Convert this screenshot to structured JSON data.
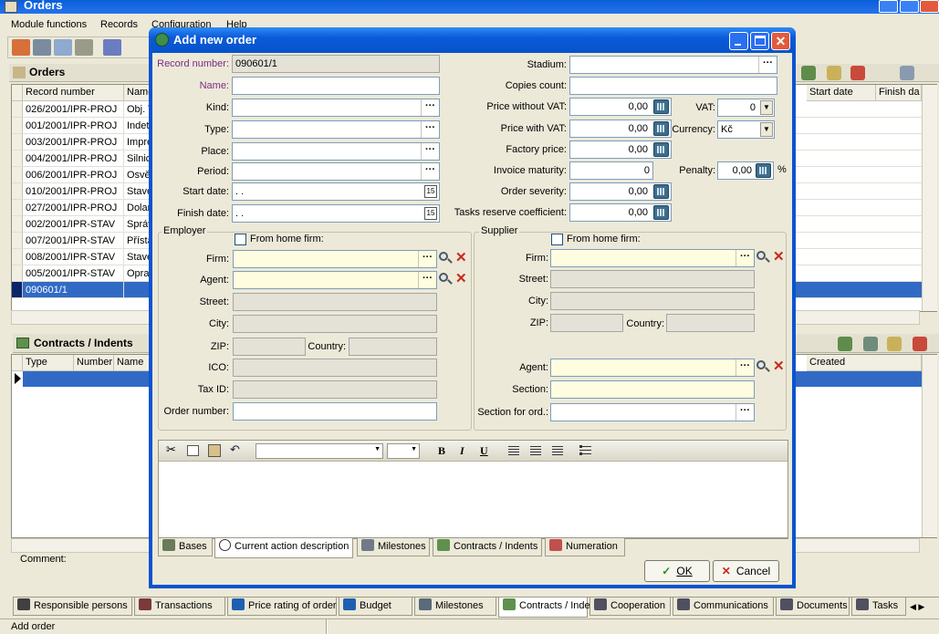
{
  "app": {
    "title": "Orders",
    "status": "Add order"
  },
  "menu": [
    "Module functions",
    "Records",
    "Configuration",
    "Help"
  ],
  "orders_panel": {
    "title": "Orders",
    "columns": [
      "Record number",
      "Name"
    ],
    "right_columns": [
      "Start date",
      "Finish da"
    ],
    "rows": [
      {
        "num": "026/2001/IPR-PROJ",
        "name": "Obj. T"
      },
      {
        "num": "001/2001/IPR-PROJ",
        "name": "Indet"
      },
      {
        "num": "003/2001/IPR-PROJ",
        "name": "Impre"
      },
      {
        "num": "004/2001/IPR-PROJ",
        "name": "Silnic"
      },
      {
        "num": "006/2001/IPR-PROJ",
        "name": "Osvě"
      },
      {
        "num": "010/2001/IPR-PROJ",
        "name": "Stave"
      },
      {
        "num": "027/2001/IPR-PROJ",
        "name": "Dolar"
      },
      {
        "num": "002/2001/IPR-STAV",
        "name": "Správ"
      },
      {
        "num": "007/2001/IPR-STAV",
        "name": "Přísta"
      },
      {
        "num": "008/2001/IPR-STAV",
        "name": "Stave"
      },
      {
        "num": "005/2001/IPR-STAV",
        "name": "Oprav"
      },
      {
        "num": "090601/1",
        "name": ""
      }
    ]
  },
  "contracts_panel": {
    "title": "Contracts / Indents",
    "columns": [
      "Type",
      "Number",
      "Name"
    ],
    "right_columns": [
      "Created"
    ],
    "comment_label": "Comment:"
  },
  "bottom_tabs": [
    "Responsible persons",
    "Transactions",
    "Price rating of order",
    "Budget",
    "Milestones",
    "Contracts / Indents",
    "Cooperation",
    "Communications",
    "Documents",
    "Tasks"
  ],
  "dialog": {
    "title": "Add new order",
    "left": {
      "record_number_label": "Record number:",
      "record_number": "090601/1",
      "name_label": "Name:",
      "kind_label": "Kind:",
      "type_label": "Type:",
      "place_label": "Place:",
      "period_label": "Period:",
      "start_date_label": "Start date:",
      "start_date": " .  .",
      "finish_date_label": "Finish date:",
      "finish_date": " .  ."
    },
    "right": {
      "stadium_label": "Stadium:",
      "copies_label": "Copies count:",
      "price_wo_vat_label": "Price without VAT:",
      "price_wo_vat": "0,00",
      "vat_label": "VAT:",
      "vat": "0",
      "price_w_vat_label": "Price with VAT:",
      "price_w_vat": "0,00",
      "currency_label": "Currency:",
      "currency": "Kč",
      "factory_price_label": "Factory price:",
      "factory_price": "0,00",
      "invoice_maturity_label": "Invoice maturity:",
      "invoice_maturity": "0",
      "penalty_label": "Penalty:",
      "penalty": "0,00",
      "penalty_unit": "%",
      "severity_label": "Order severity:",
      "severity": "0,00",
      "reserve_label": "Tasks reserve coefficient:",
      "reserve": "0,00"
    },
    "employer": {
      "title": "Employer",
      "home_firm_label": "From home firm:",
      "firm_label": "Firm:",
      "agent_label": "Agent:",
      "street_label": "Street:",
      "city_label": "City:",
      "zip_label": "ZIP:",
      "country_label": "Country:",
      "ico_label": "ICO:",
      "taxid_label": "Tax ID:",
      "order_number_label": "Order number:"
    },
    "supplier": {
      "title": "Supplier",
      "home_firm_label": "From home firm:",
      "firm_label": "Firm:",
      "street_label": "Street:",
      "city_label": "City:",
      "zip_label": "ZIP:",
      "country_label": "Country:",
      "agent_label": "Agent:",
      "section_label": "Section:",
      "section_ord_label": "Section for ord.:"
    },
    "editor_buttons": {
      "bold": "B",
      "italic": "I",
      "underline": "U"
    },
    "tabs": [
      "Bases",
      "Current action description",
      "Milestones",
      "Contracts / Indents",
      "Numeration"
    ],
    "ok": "OK",
    "cancel": "Cancel"
  }
}
